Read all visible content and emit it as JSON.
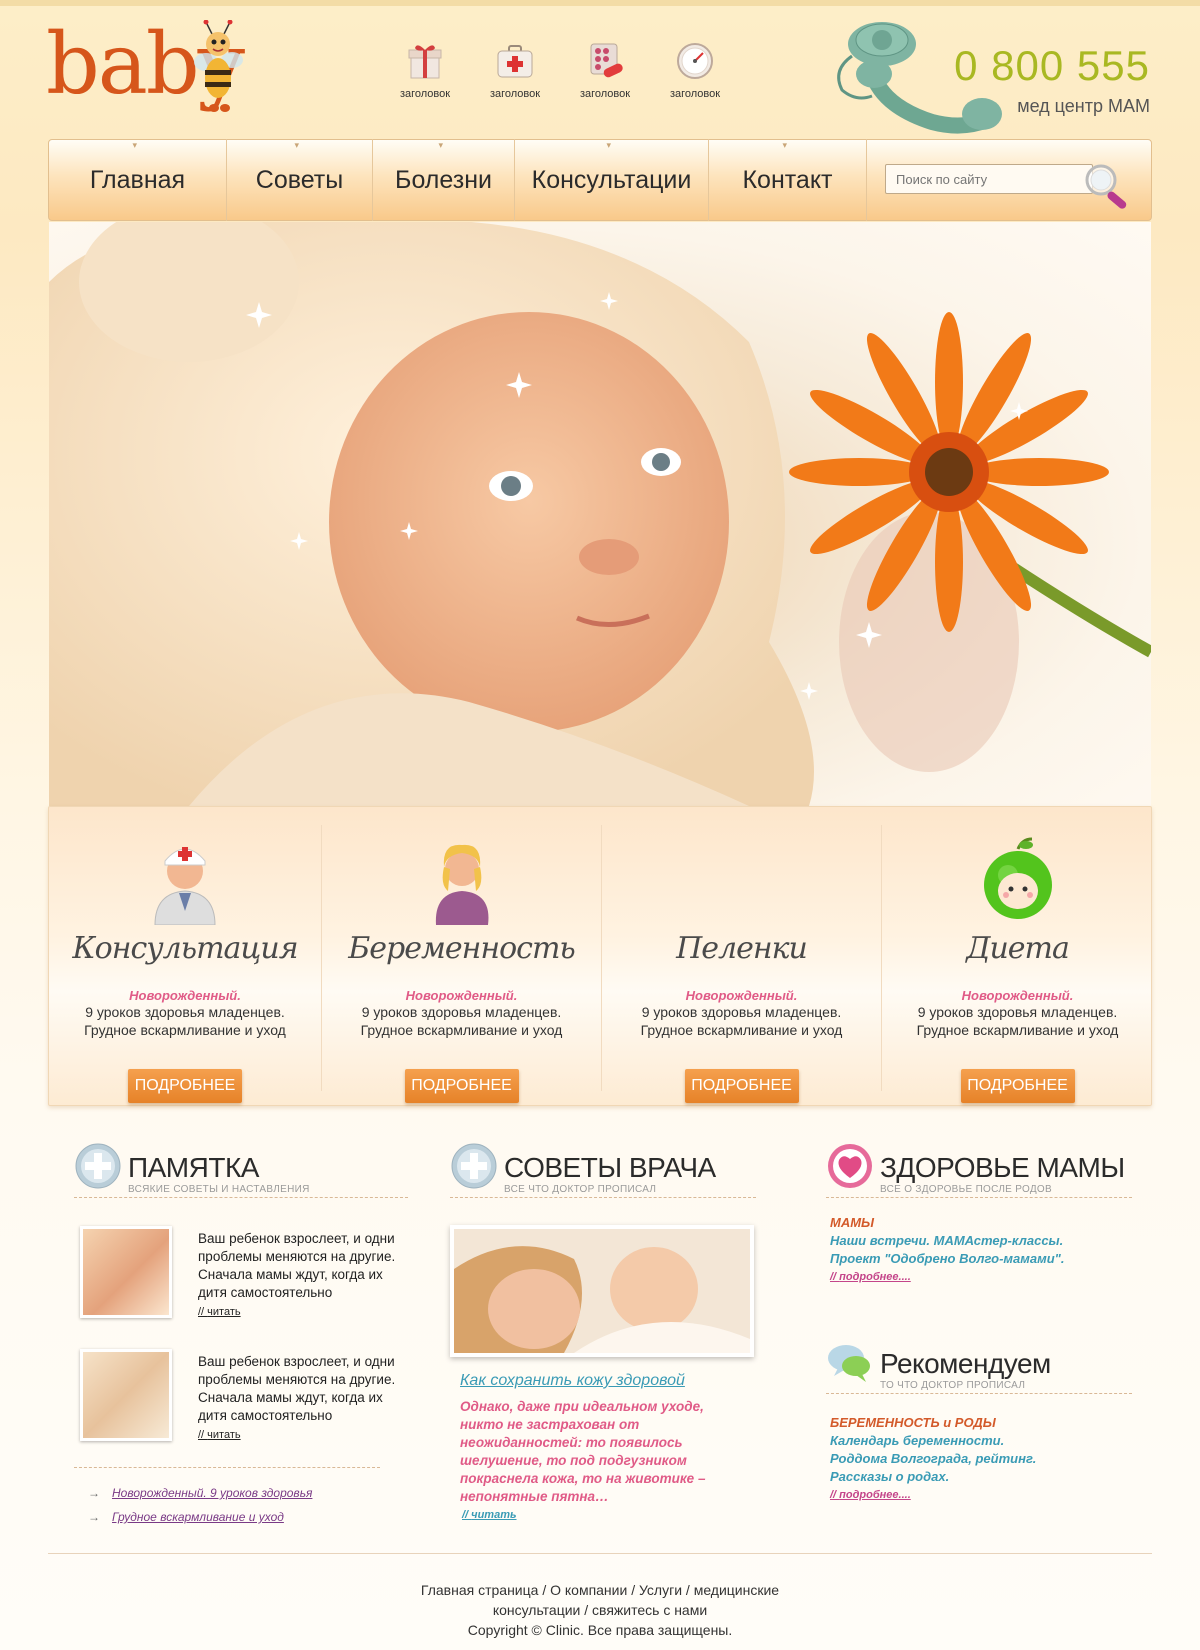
{
  "header": {
    "logo_text": "baby",
    "top_links": [
      {
        "icon": "gift-icon",
        "label": "заголовок"
      },
      {
        "icon": "first-aid-kit-icon",
        "label": "заголовок"
      },
      {
        "icon": "pills-icon",
        "label": "заголовок"
      },
      {
        "icon": "gauge-icon",
        "label": "заголовок"
      }
    ],
    "phone_number": "0 800 555",
    "phone_caption": "мед центр МАМ"
  },
  "nav": {
    "items": [
      "Главная",
      "Советы",
      "Болезни",
      "Консультации",
      "Контакт"
    ],
    "search_placeholder": "Поиск по сайту"
  },
  "features": [
    {
      "title": "Консультация",
      "sub": "Новорожденный.",
      "line1": "9 уроков здоровья младенцев.",
      "line2": "Грудное вскармливание и уход",
      "button": "ПОДРОБНЕЕ",
      "icon": "doctor-icon"
    },
    {
      "title": "Беременность",
      "sub": "Новорожденный.",
      "line1": "9 уроков здоровья младенцев.",
      "line2": "Грудное вскармливание и уход",
      "button": "ПОДРОБНЕЕ",
      "icon": "pregnant-woman-icon"
    },
    {
      "title": "Пеленки",
      "sub": "Новорожденный.",
      "line1": "9 уроков здоровья младенцев.",
      "line2": "Грудное вскармливание и уход",
      "button": "ПОДРОБНЕЕ",
      "icon": "diaper-icon"
    },
    {
      "title": "Диета",
      "sub": "Новорожденный.",
      "line1": "9 уроков здоровья младенцев.",
      "line2": "Грудное вскармливание и уход",
      "button": "ПОДРОБНЕЕ",
      "icon": "apple-face-icon"
    }
  ],
  "memo": {
    "title": "ПАМЯТКА",
    "subtitle": "ВСЯКИЕ СОВЕТЫ И НАСТАВЛЕНИЯ",
    "items": [
      {
        "text": "Ваш ребенок взрослеет, и одни проблемы меняются на другие. Сначала мамы ждут, когда их дитя самостоятельно",
        "read": "читать"
      },
      {
        "text": "Ваш ребенок взрослеет, и одни проблемы меняются на другие. Сначала мамы ждут, когда их дитя самостоятельно",
        "read": "читать"
      }
    ],
    "links": [
      "Новорожденный. 9 уроков здоровья",
      "Грудное вскармливание и уход"
    ]
  },
  "doctor": {
    "title": "СОВЕТЫ ВРАЧА",
    "subtitle": "ВСЕ ЧТО ДОКТОР ПРОПИСАЛ",
    "article_title": "Как сохранить кожу здоровой",
    "article_text": "Однако, даже при идеальном уходе, никто не застрахован от неожиданностей: то появилось шелушение, то под подгузником покраснела кожа, то на животике – непонятные пятна…",
    "read": "читать"
  },
  "mom_health": {
    "title": "ЗДОРОВЬЕ МАМЫ",
    "subtitle": "ВСЕ О ЗДОРОВЬЕ ПОСЛЕ РОДОВ",
    "category": "МАМЫ",
    "lines": [
      "Наши встречи. МАМАстер-классы.",
      "Проект \"Одобрено Волго-мамами\"."
    ],
    "more": "подробнее...."
  },
  "recommend": {
    "title": "Рекомендуем",
    "subtitle": "ТО ЧТО ДОКТОР ПРОПИСАЛ",
    "category": "БЕРЕМЕННОСТЬ и РОДЫ",
    "lines": [
      "Календарь беременности.",
      "Роддома Волгограда, рейтинг.",
      "Рассказы о родах."
    ],
    "more": "подробнее...."
  },
  "footer": {
    "line1": "Главная страница / О компании / Услуги / медицинские",
    "line2": "консультации / свяжитесь с нами",
    "line3": "Copyright © Clinic. Все права защищены."
  },
  "colors": {
    "accent": "#e68228",
    "pink": "#e05b87",
    "teal": "#3a9bb5",
    "phone_green": "#a9b822"
  }
}
